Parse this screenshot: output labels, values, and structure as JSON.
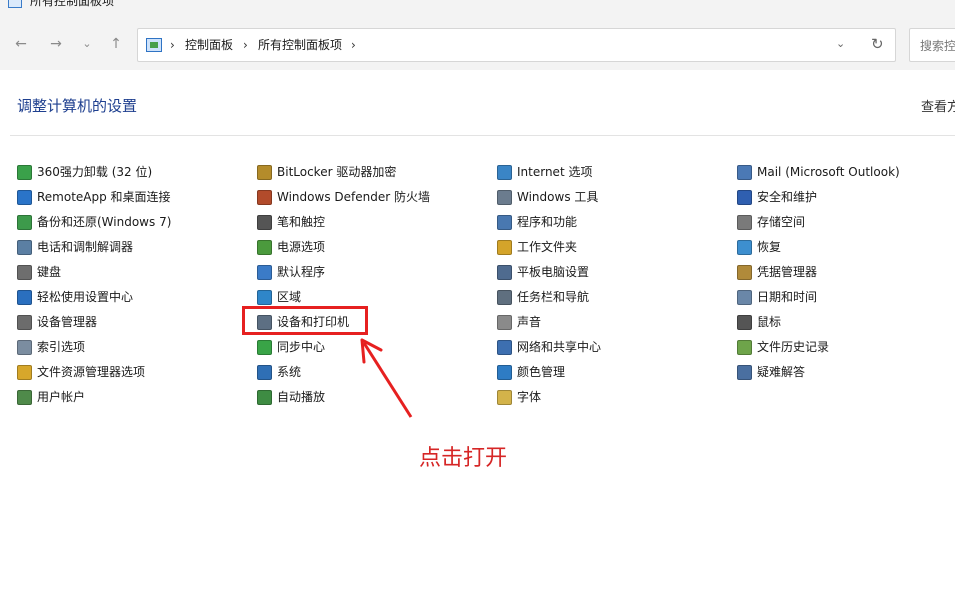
{
  "window": {
    "title": "所有控制面板项"
  },
  "address": {
    "crumbs": [
      "控制面板",
      "所有控制面板项"
    ],
    "sep": "›"
  },
  "search": {
    "placeholder": "搜索控"
  },
  "header": {
    "title": "调整计算机的设置",
    "view_by": "查看方"
  },
  "colors": {
    "link": "#1e3f8f",
    "annotation": "#e62020"
  },
  "items": [
    [
      {
        "label": "360强力卸载 (32 位)",
        "icon": "uninstall-icon",
        "color": "#3aa14a"
      },
      {
        "label": "RemoteApp 和桌面连接",
        "icon": "remote-desktop-icon",
        "color": "#2a74c8"
      },
      {
        "label": "备份和还原(Windows 7)",
        "icon": "backup-icon",
        "color": "#3d9a4b"
      },
      {
        "label": "电话和调制解调器",
        "icon": "phone-modem-icon",
        "color": "#5b7fa3"
      },
      {
        "label": "键盘",
        "icon": "keyboard-icon",
        "color": "#6e6e6e"
      },
      {
        "label": "轻松使用设置中心",
        "icon": "ease-of-access-icon",
        "color": "#2a6fbf"
      },
      {
        "label": "设备管理器",
        "icon": "device-manager-icon",
        "color": "#6c6c6c"
      },
      {
        "label": "索引选项",
        "icon": "indexing-icon",
        "color": "#7b8da0"
      },
      {
        "label": "文件资源管理器选项",
        "icon": "folder-options-icon",
        "color": "#d7a72b"
      },
      {
        "label": "用户帐户",
        "icon": "user-accounts-icon",
        "color": "#4f8a4a"
      }
    ],
    [
      {
        "label": "BitLocker 驱动器加密",
        "icon": "bitlocker-icon",
        "color": "#b48c2b"
      },
      {
        "label": "Windows Defender 防火墙",
        "icon": "firewall-icon",
        "color": "#b24b2b"
      },
      {
        "label": "笔和触控",
        "icon": "pen-touch-icon",
        "color": "#555555"
      },
      {
        "label": "电源选项",
        "icon": "power-options-icon",
        "color": "#4b9a3d"
      },
      {
        "label": "默认程序",
        "icon": "default-programs-icon",
        "color": "#3b7bc7"
      },
      {
        "label": "区域",
        "icon": "region-icon",
        "color": "#2f86c9"
      },
      {
        "label": "设备和打印机",
        "icon": "printer-icon",
        "color": "#5d6f83"
      },
      {
        "label": "同步中心",
        "icon": "sync-center-icon",
        "color": "#39a447"
      },
      {
        "label": "系统",
        "icon": "system-icon",
        "color": "#2f6fb5"
      },
      {
        "label": "自动播放",
        "icon": "autoplay-icon",
        "color": "#3e8c43"
      }
    ],
    [
      {
        "label": "Internet 选项",
        "icon": "internet-options-icon",
        "color": "#3a85c6"
      },
      {
        "label": "Windows 工具",
        "icon": "windows-tools-icon",
        "color": "#6b7c8e"
      },
      {
        "label": "程序和功能",
        "icon": "programs-features-icon",
        "color": "#4978b0"
      },
      {
        "label": "工作文件夹",
        "icon": "work-folders-icon",
        "color": "#d4a42a"
      },
      {
        "label": "平板电脑设置",
        "icon": "tablet-settings-icon",
        "color": "#4f6b8f"
      },
      {
        "label": "任务栏和导航",
        "icon": "taskbar-icon",
        "color": "#5f6f7f"
      },
      {
        "label": "声音",
        "icon": "sound-icon",
        "color": "#8a8a8a"
      },
      {
        "label": "网络和共享中心",
        "icon": "network-icon",
        "color": "#3d6fb0"
      },
      {
        "label": "颜色管理",
        "icon": "color-management-icon",
        "color": "#2e7cc4"
      },
      {
        "label": "字体",
        "icon": "fonts-icon",
        "color": "#d3b34a"
      }
    ],
    [
      {
        "label": "Mail (Microsoft Outlook)",
        "icon": "mail-icon",
        "color": "#4b79b5"
      },
      {
        "label": "安全和维护",
        "icon": "security-maintenance-icon",
        "color": "#2f5fb0"
      },
      {
        "label": "存储空间",
        "icon": "storage-spaces-icon",
        "color": "#7a7a7a"
      },
      {
        "label": "恢复",
        "icon": "recovery-icon",
        "color": "#3d8fcf"
      },
      {
        "label": "凭据管理器",
        "icon": "credential-manager-icon",
        "color": "#b08a3a"
      },
      {
        "label": "日期和时间",
        "icon": "date-time-icon",
        "color": "#6a87a8"
      },
      {
        "label": "鼠标",
        "icon": "mouse-icon",
        "color": "#555555"
      },
      {
        "label": "文件历史记录",
        "icon": "file-history-icon",
        "color": "#6ea44a"
      },
      {
        "label": "疑难解答",
        "icon": "troubleshooting-icon",
        "color": "#4a6fa0"
      }
    ]
  ],
  "annotation": {
    "note": "点击打开"
  }
}
